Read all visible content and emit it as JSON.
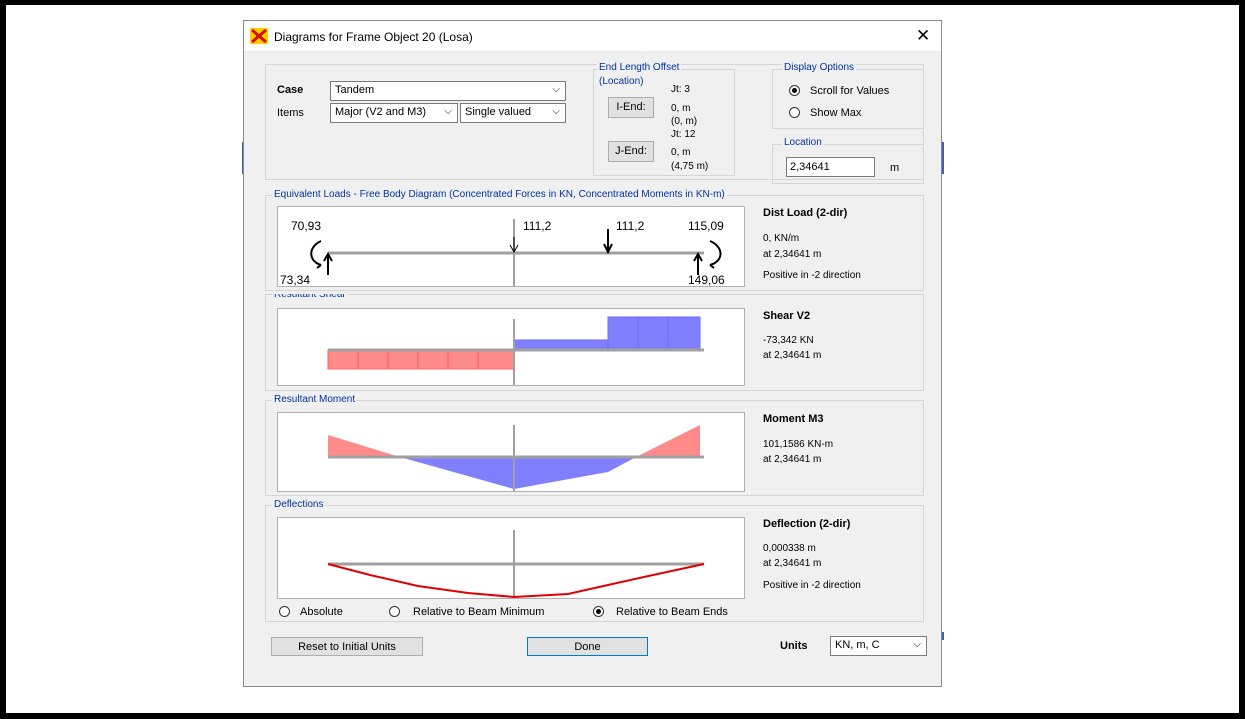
{
  "window": {
    "title": "Diagrams for Frame Object 20  (Losa)",
    "close_glyph": "✕"
  },
  "case": {
    "label": "Case",
    "value": "Tandem"
  },
  "items": {
    "label": "Items",
    "value": "Major (V2 and M3)",
    "mode": "Single valued"
  },
  "end_length_offset": {
    "title": "End Length Offset",
    "subtitle": "(Location)",
    "i_end": {
      "button": "I-End:",
      "joint": "Jt:  3",
      "value": "0, m",
      "location": "(0, m)"
    },
    "j_end": {
      "button": "J-End:",
      "joint": "Jt:  12",
      "value": "0, m",
      "location": "(4,75 m)"
    }
  },
  "display_options": {
    "title": "Display Options",
    "options": [
      {
        "label": "Scroll for Values",
        "selected": true
      },
      {
        "label": "Show Max",
        "selected": false
      }
    ]
  },
  "location": {
    "title": "Location",
    "value": "2,34641",
    "unit": "m"
  },
  "equivalent_loads": {
    "title": "Equivalent Loads - Free Body Diagram  (Concentrated Forces in KN, Concentrated Moments in KN-m)",
    "labels": {
      "moment_left": "70,93",
      "force_mid1": "111,2",
      "force_mid2": "111,2",
      "moment_right": "115,09",
      "reaction_left": "73,34",
      "reaction_right": "149,06"
    },
    "info_title": "Dist Load (2-dir)",
    "info_value": "0, KN/m",
    "info_at": "at 2,34641 m",
    "info_note": "Positive in -2 direction"
  },
  "shear": {
    "title": "Resultant Shear",
    "info_title": "Shear V2",
    "info_value": "-73,342 KN",
    "info_at": "at 2,34641 m"
  },
  "moment": {
    "title": "Resultant Moment",
    "info_title": "Moment M3",
    "info_value": "101,1586 KN-m",
    "info_at": "at 2,34641 m"
  },
  "deflection": {
    "title": "Deflections",
    "info_title": "Deflection (2-dir)",
    "info_value": "0,000338 m",
    "info_at": "at 2,34641 m",
    "info_note": "Positive in -2 direction",
    "modes": [
      {
        "label": "Absolute",
        "selected": false
      },
      {
        "label": "Relative to Beam Minimum",
        "selected": false
      },
      {
        "label": "Relative to Beam Ends",
        "selected": true
      }
    ]
  },
  "buttons": {
    "reset": "Reset to Initial Units",
    "done": "Done"
  },
  "units": {
    "label": "Units",
    "value": "KN, m, C"
  },
  "colors": {
    "positive_fill": "#8080ff",
    "negative_fill": "#ff8a8a",
    "deflection_line": "#e00000",
    "axis": "#a0a0a0",
    "group_title": "#0033a0"
  }
}
